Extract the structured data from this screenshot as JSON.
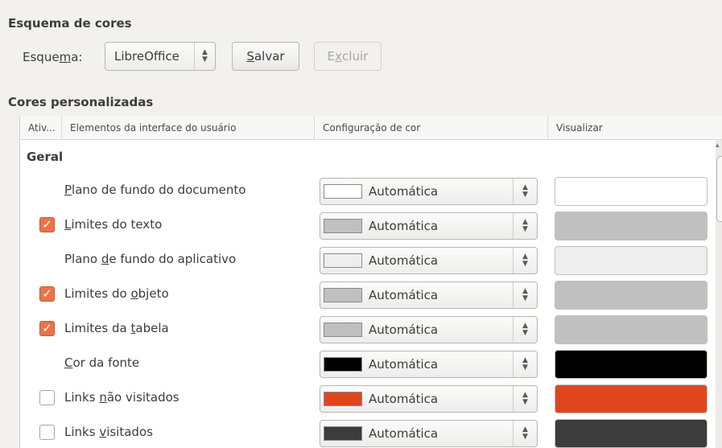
{
  "scheme_section": {
    "title": "Esquema de cores",
    "label_prefix": "Esque",
    "label_accel": "m",
    "label_suffix": "a:",
    "selected_scheme": "LibreOffice",
    "save_accel": "S",
    "save_rest": "alvar",
    "delete_prefix": "E",
    "delete_accel": "x",
    "delete_rest": "cluir"
  },
  "custom_section": {
    "title": "Cores personalizadas"
  },
  "table": {
    "headers": {
      "on": "Ativ...",
      "element": "Elementos da interface do usuário",
      "color_setting": "Configuração de cor",
      "preview": "Visualizar"
    },
    "group": "Geral",
    "rows": [
      {
        "pre": "",
        "accel": "P",
        "post": "lano de fundo do documento",
        "checkbox": "none",
        "color_name": "Automática",
        "swatch": "#ffffff",
        "preview": "#ffffff"
      },
      {
        "pre": "",
        "accel": "L",
        "post": "imites do texto",
        "checkbox": "checked",
        "color_name": "Automática",
        "swatch": "#c0c0c0",
        "preview": "#c0c0c0"
      },
      {
        "pre": "Plano ",
        "accel": "d",
        "post": "e fundo do aplicativo",
        "checkbox": "none",
        "color_name": "Automática",
        "swatch": "#eeeeee",
        "preview": "#eeeeee"
      },
      {
        "pre": "Limites do ",
        "accel": "o",
        "post": "bjeto",
        "checkbox": "checked",
        "color_name": "Automática",
        "swatch": "#c0c0c0",
        "preview": "#c0c0c0"
      },
      {
        "pre": "Limites da ",
        "accel": "t",
        "post": "abela",
        "checkbox": "checked",
        "color_name": "Automática",
        "swatch": "#c0c0c0",
        "preview": "#c0c0c0"
      },
      {
        "pre": "",
        "accel": "C",
        "post": "or da fonte",
        "checkbox": "none",
        "color_name": "Automática",
        "swatch": "#000000",
        "preview": "#000000"
      },
      {
        "pre": "Links ",
        "accel": "n",
        "post": "ão visitados",
        "checkbox": "unchecked",
        "color_name": "Automática",
        "swatch": "#e0461e",
        "preview": "#e0461e"
      },
      {
        "pre": "Links ",
        "accel": "v",
        "post": "isitados",
        "checkbox": "unchecked",
        "color_name": "Automática",
        "swatch": "#3c3c3c",
        "preview": "#3c3c3c"
      }
    ]
  },
  "colors": {
    "checkbox_checked": "#e9744c",
    "background": "#f2f1f0"
  }
}
